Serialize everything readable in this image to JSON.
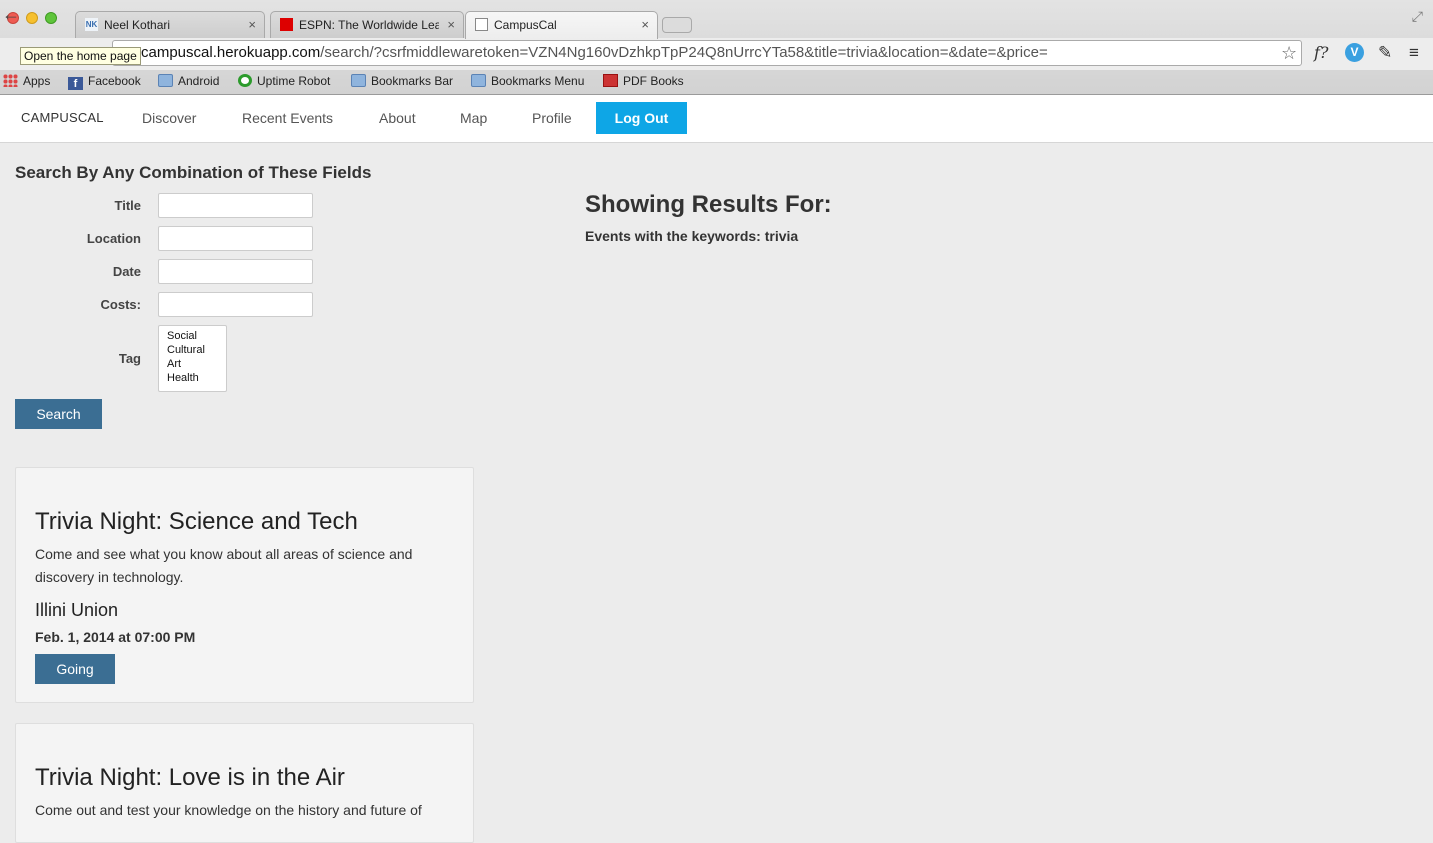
{
  "browser": {
    "tabs": [
      {
        "title": "Neel Kothari",
        "close": "×"
      },
      {
        "title": "ESPN: The Worldwide Lead",
        "close": "×"
      },
      {
        "title": "CampusCal",
        "close": "×"
      }
    ],
    "tooltip": "Open the home page",
    "url_host": "campuscal.herokuapp.com",
    "url_path": "/search/?csrfmiddlewaretoken=VZN4Ng160vDzhkpTpP24Q8nUrrcYTa58&title=trivia&location=&date=&price=",
    "icons": {
      "back": "arrow-left-icon",
      "star": "star-icon",
      "menu": "menu-icon"
    },
    "extensions": {
      "f": "f?",
      "v": "V"
    },
    "bookmarks": [
      "Apps",
      "Facebook",
      "Android",
      "Uptime Robot",
      "Bookmarks Bar",
      "Bookmarks Menu",
      "PDF Books"
    ]
  },
  "navbar": {
    "brand": "CAMPUSCAL",
    "items": [
      "Discover",
      "Recent Events",
      "About",
      "Map",
      "Profile"
    ],
    "logout": "Log Out",
    "accent": "#0ea6e6"
  },
  "search": {
    "heading": "Search By Any Combination of These Fields",
    "fields": [
      {
        "label": "Title",
        "value": ""
      },
      {
        "label": "Location",
        "value": ""
      },
      {
        "label": "Date",
        "value": ""
      },
      {
        "label": "Costs:",
        "value": ""
      }
    ],
    "tag_label": "Tag",
    "tag_options": [
      "Social",
      "Cultural",
      "Art",
      "Health"
    ],
    "button": "Search",
    "button_color": "#3b6e93"
  },
  "results": {
    "title": "Showing Results For:",
    "keywords_text": "Events with the keywords: trivia"
  },
  "events": [
    {
      "title": "Trivia Night: Science and Tech",
      "description": "Come and see what you know about all areas of science and discovery in technology.",
      "location": "Illini Union",
      "date": "Feb. 1, 2014 at 07:00 PM",
      "action": "Going"
    },
    {
      "title": "Trivia Night: Love is in the Air",
      "description": "Come out and test your knowledge on the history and future of"
    }
  ]
}
